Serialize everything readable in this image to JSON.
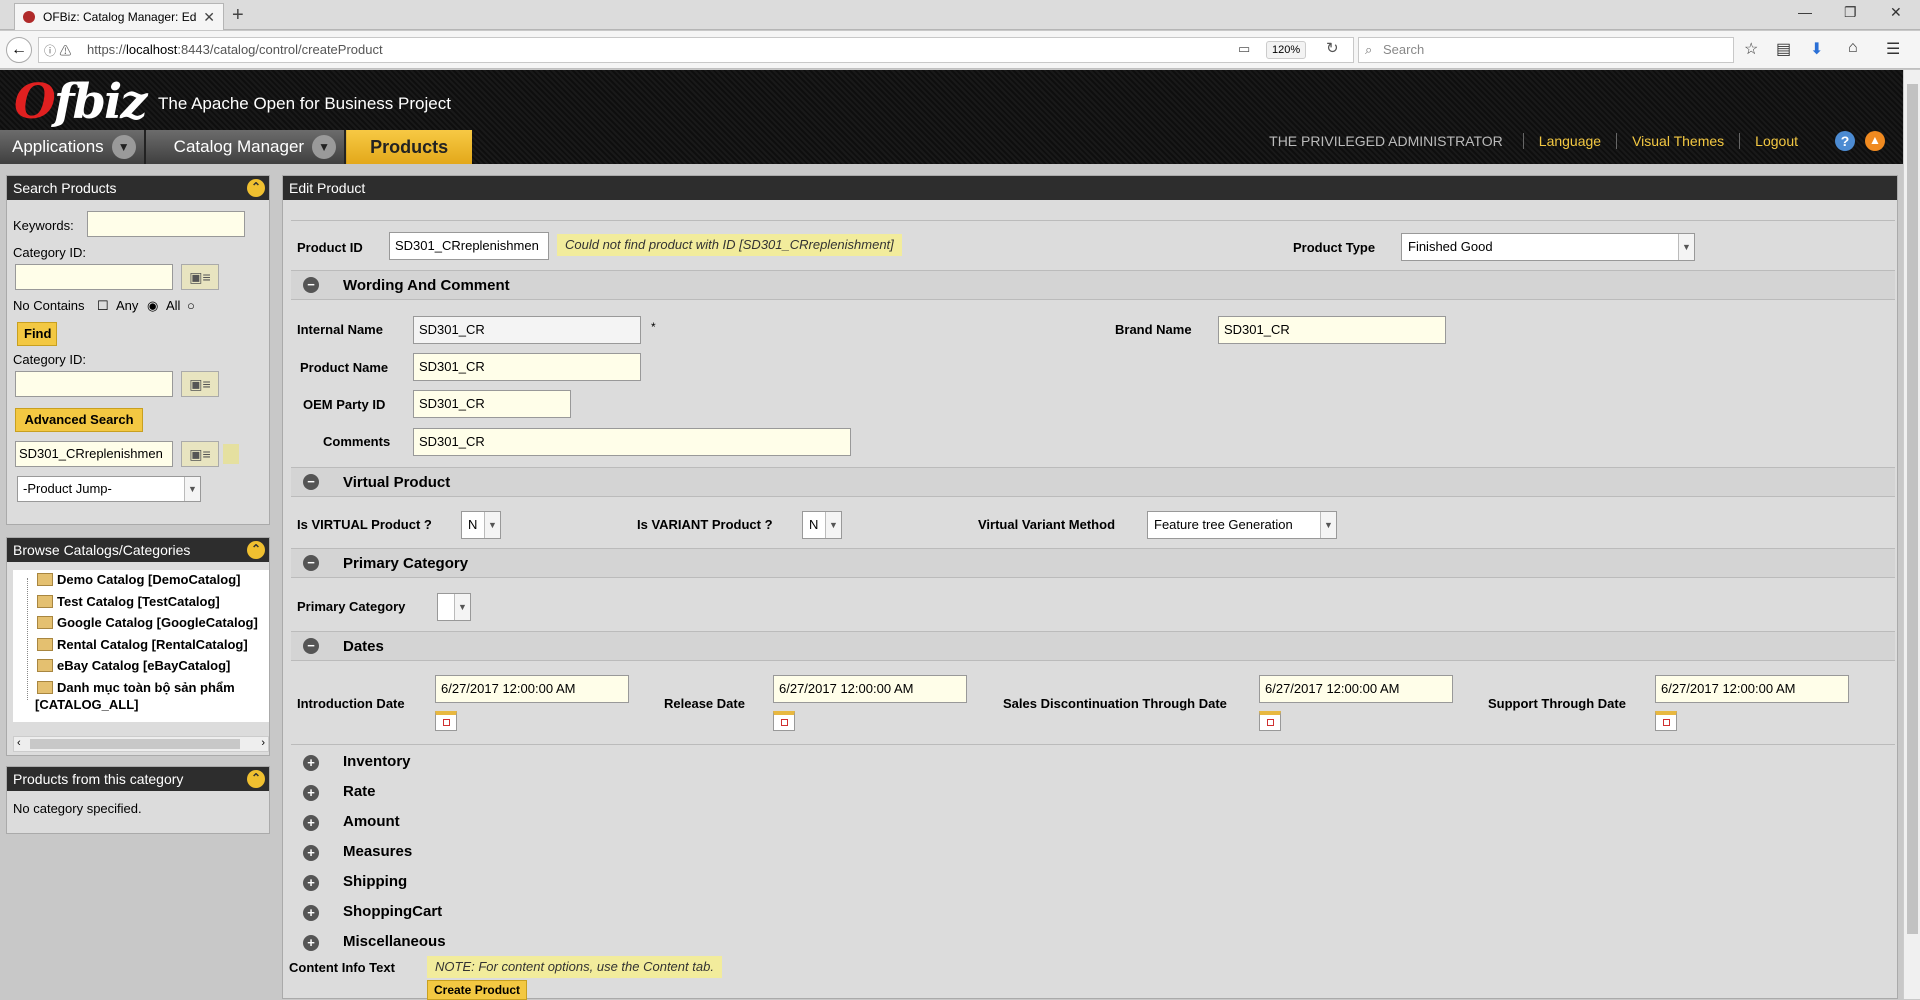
{
  "browser": {
    "tab_title": "OFBiz: Catalog Manager: Edi",
    "url_prefix": "https://",
    "url_host": "localhost",
    "url_rest": ":8443/catalog/control/createProduct",
    "zoom": "120%",
    "search_placeholder": "Search"
  },
  "header": {
    "logo_o": "O",
    "logo_rest": "fbiz",
    "tagline": "The Apache Open for Business Project",
    "nav": {
      "applications": "Applications",
      "catalog_manager": "Catalog Manager",
      "products": "Products"
    },
    "user": "THE PRIVILEGED ADMINISTRATOR",
    "language": "Language",
    "visual_themes": "Visual Themes",
    "logout": "Logout",
    "help": "?"
  },
  "search_products": {
    "title": "Search Products",
    "keywords_label": "Keywords:",
    "category_id_label": "Category ID:",
    "no_contains": "No Contains",
    "any": "Any",
    "all": "All",
    "find": "Find",
    "category_id_label2": "Category ID:",
    "advanced_search": "Advanced Search",
    "product_id_value": "SD301_CRreplenishmen",
    "product_jump": "-Product Jump-"
  },
  "browse": {
    "title": "Browse Catalogs/Categories",
    "items": [
      "Demo Catalog [DemoCatalog]",
      "Test Catalog [TestCatalog]",
      "Google Catalog [GoogleCatalog]",
      "Rental Catalog [RentalCatalog]",
      "eBay Catalog [eBayCatalog]",
      "Danh mục toàn bộ sản phẩm"
    ],
    "item6_line2": "[CATALOG_ALL]"
  },
  "products_from_category": {
    "title": "Products from this category",
    "empty": "No category specified."
  },
  "edit_product": {
    "title": "Edit Product",
    "product_id_label": "Product ID",
    "product_id_value": "SD301_CRreplenishmen",
    "not_found": "Could not find product with ID [SD301_CRreplenishment]",
    "product_type_label": "Product Type",
    "product_type_value": "Finished Good",
    "wording_section": "Wording And Comment",
    "internal_name_label": "Internal Name",
    "internal_name_value": "SD301_CR",
    "required_mark": "*",
    "brand_name_label": "Brand Name",
    "brand_name_value": "SD301_CR",
    "product_name_label": "Product Name",
    "product_name_value": "SD301_CR",
    "oem_party_label": "OEM Party ID",
    "oem_party_value": "SD301_CR",
    "comments_label": "Comments",
    "comments_value": "SD301_CR",
    "virtual_section": "Virtual Product",
    "is_virtual_label": "Is VIRTUAL Product ?",
    "is_virtual_value": "N",
    "is_variant_label": "Is VARIANT Product ?",
    "is_variant_value": "N",
    "vvm_label": "Virtual Variant Method",
    "vvm_value": "Feature tree Generation",
    "primary_cat_section": "Primary Category",
    "primary_cat_label": "Primary Category",
    "dates_section": "Dates",
    "intro_label": "Introduction Date",
    "intro_value": "6/27/2017 12:00:00 AM",
    "release_label": "Release Date",
    "release_value": "6/27/2017 12:00:00 AM",
    "sales_disc_label": "Sales Discontinuation Through Date",
    "sales_disc_value": "6/27/2017 12:00:00 AM",
    "support_label": "Support Through Date",
    "support_value": "6/27/2017 12:00:00 AM",
    "collapsed_sections": [
      "Inventory",
      "Rate",
      "Amount",
      "Measures",
      "Shipping",
      "ShoppingCart",
      "Miscellaneous"
    ],
    "content_info_label": "Content Info Text",
    "content_info_note": "NOTE: For content options, use the Content tab.",
    "create_button": "Create Product"
  }
}
